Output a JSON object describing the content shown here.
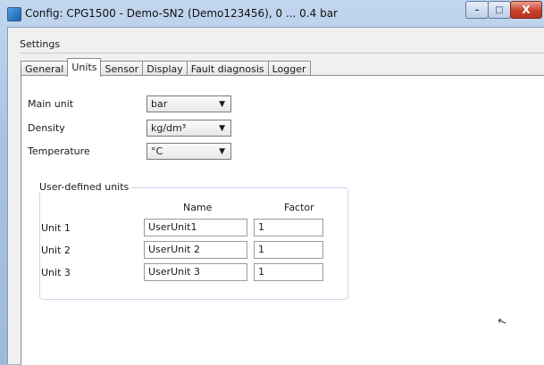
{
  "window": {
    "title": "Config: CPG1500 - Demo-SN2 (Demo123456), 0 ... 0.4 bar",
    "min_glyph": "–",
    "max_glyph": "□",
    "close_glyph": "X"
  },
  "settings_label": "Settings",
  "tabs": [
    {
      "label": "General",
      "active": false
    },
    {
      "label": "Units",
      "active": true
    },
    {
      "label": "Sensor",
      "active": false
    },
    {
      "label": "Display",
      "active": false
    },
    {
      "label": "Fault diagnosis",
      "active": false
    },
    {
      "label": "Logger",
      "active": false
    }
  ],
  "units": {
    "main_unit": {
      "label": "Main unit",
      "value": "bar"
    },
    "density": {
      "label": "Density",
      "value": "kg/dm³"
    },
    "temperature": {
      "label": "Temperature",
      "value": "°C"
    }
  },
  "combo_arrow": "▼",
  "user_defined": {
    "legend": "User-defined units",
    "col_name": "Name",
    "col_factor": "Factor",
    "rows": [
      {
        "label": "Unit 1",
        "name": "UserUnit1",
        "factor": "1"
      },
      {
        "label": "Unit 2",
        "name": "UserUnit 2",
        "factor": "1"
      },
      {
        "label": "Unit 3",
        "name": "UserUnit 3",
        "factor": "1"
      }
    ]
  },
  "cursor_glyph": "↖"
}
